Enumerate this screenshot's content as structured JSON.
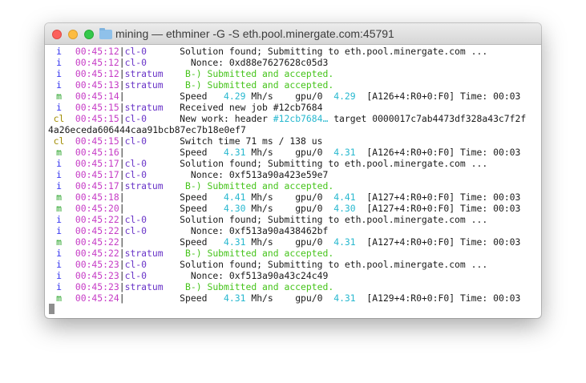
{
  "window": {
    "title": "mining — ethminer -G -S eth.pool.minergate.com:45791"
  },
  "terminal": {
    "lines": [
      {
        "level": "i",
        "segments": [
          {
            "t": "00:45:12",
            "c": "ts"
          },
          {
            "t": "|",
            "c": ""
          },
          {
            "t": "cl-0      ",
            "c": "src"
          },
          {
            "t": "Solution found; Submitting to eth.pool.minergate.com ...",
            "c": ""
          }
        ]
      },
      {
        "level": "i",
        "segments": [
          {
            "t": "00:45:12",
            "c": "ts"
          },
          {
            "t": "|",
            "c": ""
          },
          {
            "t": "cl-0      ",
            "c": "src"
          },
          {
            "t": "  Nonce: 0xd88e7627628c05d3",
            "c": ""
          }
        ]
      },
      {
        "level": "i",
        "segments": [
          {
            "t": "00:45:12",
            "c": "ts"
          },
          {
            "t": "|",
            "c": ""
          },
          {
            "t": "stratum   ",
            "c": "src"
          },
          {
            "t": " B-) Submitted and accepted.",
            "c": "green"
          }
        ]
      },
      {
        "level": "i",
        "segments": [
          {
            "t": "00:45:13",
            "c": "ts"
          },
          {
            "t": "|",
            "c": ""
          },
          {
            "t": "stratum   ",
            "c": "src"
          },
          {
            "t": " B-) Submitted and accepted.",
            "c": "green"
          }
        ]
      },
      {
        "level": "m",
        "segments": [
          {
            "t": "00:45:14",
            "c": "ts"
          },
          {
            "t": "|",
            "c": ""
          },
          {
            "t": "          ",
            "c": ""
          },
          {
            "t": "Speed   ",
            "c": ""
          },
          {
            "t": "4.29",
            "c": "cyan"
          },
          {
            "t": " Mh/s    gpu/0  ",
            "c": ""
          },
          {
            "t": "4.29",
            "c": "cyan"
          },
          {
            "t": "  [A126+4:R0+0:F0] Time: 00:03",
            "c": ""
          }
        ]
      },
      {
        "level": "i",
        "segments": [
          {
            "t": "00:45:15",
            "c": "ts"
          },
          {
            "t": "|",
            "c": ""
          },
          {
            "t": "stratum   ",
            "c": "src"
          },
          {
            "t": "Received new job #12cb7684",
            "c": ""
          }
        ]
      },
      {
        "level": "cl",
        "segments": [
          {
            "t": "00:45:15",
            "c": "ts"
          },
          {
            "t": "|",
            "c": ""
          },
          {
            "t": "cl-0      ",
            "c": "src"
          },
          {
            "t": "New work: header ",
            "c": ""
          },
          {
            "t": "#12cb7684…",
            "c": "cyan"
          },
          {
            "t": " target 0000017c7ab4473df328a43c7f2f",
            "c": ""
          }
        ]
      },
      {
        "level": "",
        "segments": [
          {
            "t": "4a26eceda606444caa91bcb87ec7b18e0ef7",
            "c": ""
          }
        ]
      },
      {
        "level": "cl",
        "segments": [
          {
            "t": "00:45:15",
            "c": "ts"
          },
          {
            "t": "|",
            "c": ""
          },
          {
            "t": "cl-0      ",
            "c": "src"
          },
          {
            "t": "Switch time 71 ms / 138 us",
            "c": ""
          }
        ]
      },
      {
        "level": "m",
        "segments": [
          {
            "t": "00:45:16",
            "c": "ts"
          },
          {
            "t": "|",
            "c": ""
          },
          {
            "t": "          ",
            "c": ""
          },
          {
            "t": "Speed   ",
            "c": ""
          },
          {
            "t": "4.31",
            "c": "cyan"
          },
          {
            "t": " Mh/s    gpu/0  ",
            "c": ""
          },
          {
            "t": "4.31",
            "c": "cyan"
          },
          {
            "t": "  [A126+4:R0+0:F0] Time: 00:03",
            "c": ""
          }
        ]
      },
      {
        "level": "i",
        "segments": [
          {
            "t": "00:45:17",
            "c": "ts"
          },
          {
            "t": "|",
            "c": ""
          },
          {
            "t": "cl-0      ",
            "c": "src"
          },
          {
            "t": "Solution found; Submitting to eth.pool.minergate.com ...",
            "c": ""
          }
        ]
      },
      {
        "level": "i",
        "segments": [
          {
            "t": "00:45:17",
            "c": "ts"
          },
          {
            "t": "|",
            "c": ""
          },
          {
            "t": "cl-0      ",
            "c": "src"
          },
          {
            "t": "  Nonce: 0xf513a90a423e59e7",
            "c": ""
          }
        ]
      },
      {
        "level": "i",
        "segments": [
          {
            "t": "00:45:17",
            "c": "ts"
          },
          {
            "t": "|",
            "c": ""
          },
          {
            "t": "stratum   ",
            "c": "src"
          },
          {
            "t": " B-) Submitted and accepted.",
            "c": "green"
          }
        ]
      },
      {
        "level": "m",
        "segments": [
          {
            "t": "00:45:18",
            "c": "ts"
          },
          {
            "t": "|",
            "c": ""
          },
          {
            "t": "          ",
            "c": ""
          },
          {
            "t": "Speed   ",
            "c": ""
          },
          {
            "t": "4.41",
            "c": "cyan"
          },
          {
            "t": " Mh/s    gpu/0  ",
            "c": ""
          },
          {
            "t": "4.41",
            "c": "cyan"
          },
          {
            "t": "  [A127+4:R0+0:F0] Time: 00:03",
            "c": ""
          }
        ]
      },
      {
        "level": "m",
        "segments": [
          {
            "t": "00:45:20",
            "c": "ts"
          },
          {
            "t": "|",
            "c": ""
          },
          {
            "t": "          ",
            "c": ""
          },
          {
            "t": "Speed   ",
            "c": ""
          },
          {
            "t": "4.30",
            "c": "cyan"
          },
          {
            "t": " Mh/s    gpu/0  ",
            "c": ""
          },
          {
            "t": "4.30",
            "c": "cyan"
          },
          {
            "t": "  [A127+4:R0+0:F0] Time: 00:03",
            "c": ""
          }
        ]
      },
      {
        "level": "i",
        "segments": [
          {
            "t": "00:45:22",
            "c": "ts"
          },
          {
            "t": "|",
            "c": ""
          },
          {
            "t": "cl-0      ",
            "c": "src"
          },
          {
            "t": "Solution found; Submitting to eth.pool.minergate.com ...",
            "c": ""
          }
        ]
      },
      {
        "level": "i",
        "segments": [
          {
            "t": "00:45:22",
            "c": "ts"
          },
          {
            "t": "|",
            "c": ""
          },
          {
            "t": "cl-0      ",
            "c": "src"
          },
          {
            "t": "  Nonce: 0xf513a90a438462bf",
            "c": ""
          }
        ]
      },
      {
        "level": "m",
        "segments": [
          {
            "t": "00:45:22",
            "c": "ts"
          },
          {
            "t": "|",
            "c": ""
          },
          {
            "t": "          ",
            "c": ""
          },
          {
            "t": "Speed   ",
            "c": ""
          },
          {
            "t": "4.31",
            "c": "cyan"
          },
          {
            "t": " Mh/s    gpu/0  ",
            "c": ""
          },
          {
            "t": "4.31",
            "c": "cyan"
          },
          {
            "t": "  [A127+4:R0+0:F0] Time: 00:03",
            "c": ""
          }
        ]
      },
      {
        "level": "i",
        "segments": [
          {
            "t": "00:45:22",
            "c": "ts"
          },
          {
            "t": "|",
            "c": ""
          },
          {
            "t": "stratum   ",
            "c": "src"
          },
          {
            "t": " B-) Submitted and accepted.",
            "c": "green"
          }
        ]
      },
      {
        "level": "i",
        "segments": [
          {
            "t": "00:45:23",
            "c": "ts"
          },
          {
            "t": "|",
            "c": ""
          },
          {
            "t": "cl-0      ",
            "c": "src"
          },
          {
            "t": "Solution found; Submitting to eth.pool.minergate.com ...",
            "c": ""
          }
        ]
      },
      {
        "level": "i",
        "segments": [
          {
            "t": "00:45:23",
            "c": "ts"
          },
          {
            "t": "|",
            "c": ""
          },
          {
            "t": "cl-0      ",
            "c": "src"
          },
          {
            "t": "  Nonce: 0xf513a90a43c24c49",
            "c": ""
          }
        ]
      },
      {
        "level": "i",
        "segments": [
          {
            "t": "00:45:23",
            "c": "ts"
          },
          {
            "t": "|",
            "c": ""
          },
          {
            "t": "stratum   ",
            "c": "src"
          },
          {
            "t": " B-) Submitted and accepted.",
            "c": "green"
          }
        ]
      },
      {
        "level": "m",
        "segments": [
          {
            "t": "00:45:24",
            "c": "ts"
          },
          {
            "t": "|",
            "c": ""
          },
          {
            "t": "          ",
            "c": ""
          },
          {
            "t": "Speed   ",
            "c": ""
          },
          {
            "t": "4.31",
            "c": "cyan"
          },
          {
            "t": " Mh/s    gpu/0  ",
            "c": ""
          },
          {
            "t": "4.31",
            "c": "cyan"
          },
          {
            "t": "  [A129+4:R0+0:F0] Time: 00:03",
            "c": ""
          }
        ]
      }
    ]
  }
}
